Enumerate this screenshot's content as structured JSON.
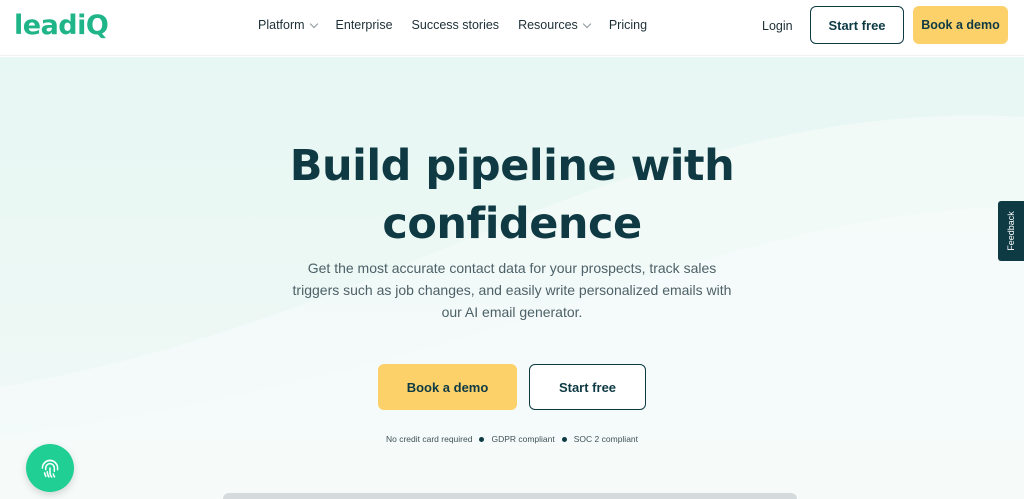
{
  "header": {
    "logo_text": "leadiQ",
    "nav": [
      {
        "label": "Platform",
        "has_dropdown": true
      },
      {
        "label": "Enterprise",
        "has_dropdown": false
      },
      {
        "label": "Success stories",
        "has_dropdown": false
      },
      {
        "label": "Resources",
        "has_dropdown": true
      },
      {
        "label": "Pricing",
        "has_dropdown": false
      }
    ],
    "login_label": "Login",
    "start_free_label": "Start free",
    "book_demo_label": "Book a demo"
  },
  "hero": {
    "headline_line1": "Build pipeline with",
    "headline_line2": "confidence",
    "subtitle": "Get the most accurate contact data for your prospects, track sales triggers such as job changes, and easily write personalized emails with our AI email generator.",
    "primary_cta": "Book a demo",
    "secondary_cta": "Start free",
    "compliance": [
      "No credit card required",
      "GDPR compliant",
      "SOC 2 compliant"
    ]
  },
  "feedback_label": "Feedback",
  "icons": {
    "chat_fab": "fingerprint-icon",
    "nav_dropdown": "chevron-down-icon"
  },
  "colors": {
    "brand_green": "#1fb589",
    "dark_teal": "#0e3a44",
    "cta_yellow": "#fcd16a",
    "fab_green": "#1fcf93"
  }
}
